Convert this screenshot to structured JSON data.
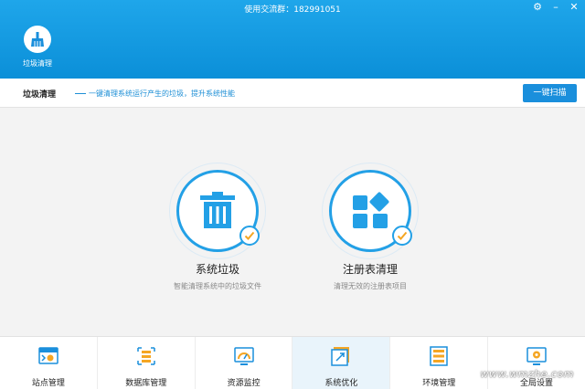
{
  "window": {
    "title": "使用交流群：182991051",
    "controls": [
      "gear-icon",
      "minimize-icon",
      "close-icon"
    ]
  },
  "top_tab": {
    "label": "垃圾清理",
    "icon": "broom-icon"
  },
  "subheader": {
    "title": "垃圾清理",
    "description": "一键清理系统运行产生的垃圾，提升系统性能",
    "scan_button": "一键扫描"
  },
  "cards": [
    {
      "title": "系统垃圾",
      "subtitle": "智能清理系统中的垃圾文件",
      "icon": "trash-icon"
    },
    {
      "title": "注册表清理",
      "subtitle": "清理无效的注册表项目",
      "icon": "registry-icon"
    }
  ],
  "bottom_nav": [
    {
      "label": "站点管理",
      "icon": "site-icon"
    },
    {
      "label": "数据库管理",
      "icon": "database-icon"
    },
    {
      "label": "资源监控",
      "icon": "monitor-icon"
    },
    {
      "label": "系统优化",
      "icon": "optimize-icon",
      "active": true
    },
    {
      "label": "环境管理",
      "icon": "server-icon"
    },
    {
      "label": "全局设置",
      "icon": "settings-icon"
    }
  ],
  "watermark": "www.wmzhe.com",
  "colors": {
    "accent": "#1a8fdc",
    "topbar": "#1fa6ea",
    "check": "#f5a623"
  }
}
